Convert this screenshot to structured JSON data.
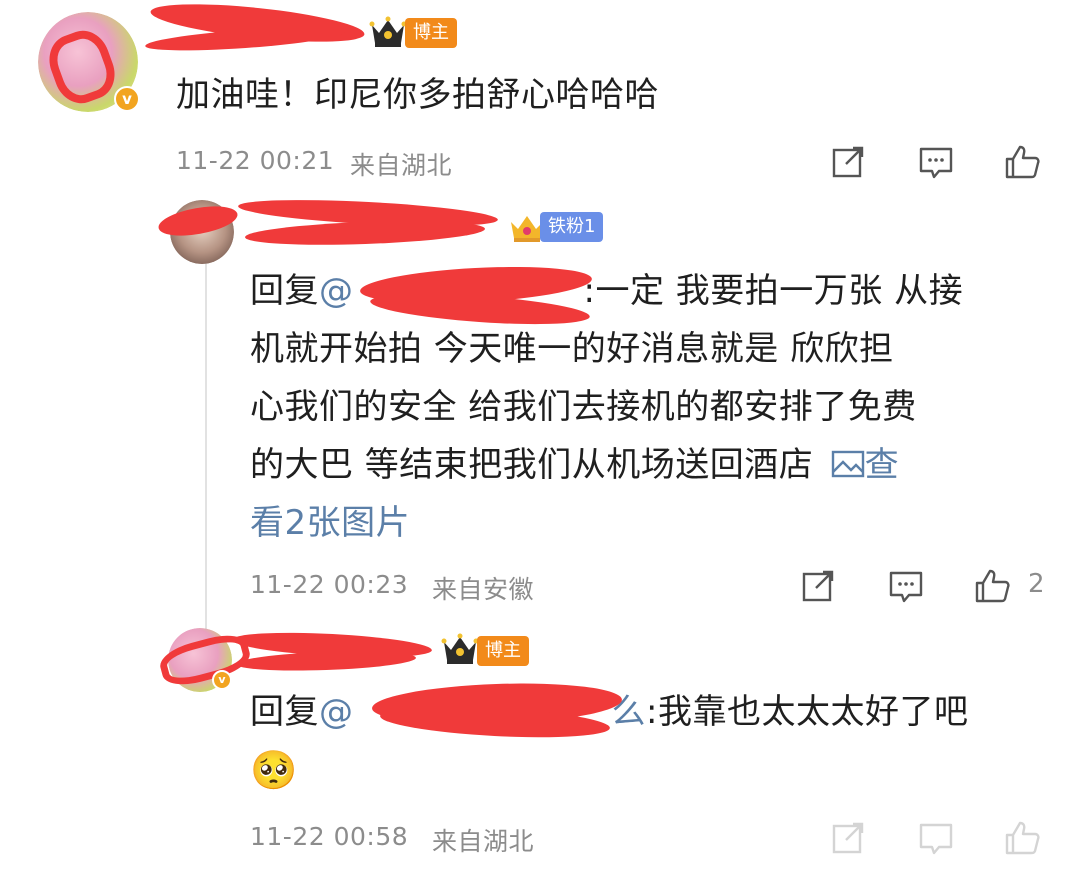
{
  "comments": [
    {
      "badge": "博主",
      "text": "加油哇！印尼你多拍舒心哈哈哈",
      "time": "11-22 00:21",
      "location": "来自湖北"
    },
    {
      "badge": "铁粉1",
      "reply_prefix": "回复",
      "mention_at": "@",
      "text": ":一定 我要拍一万张 从接机就开始拍 今天唯一的好消息就是 欣欣担心我们的安全 给我们去接机的都安排了免费的大巴 等结束把我们从机场送回酒店",
      "line1": ":一定 我要拍一万张 从接",
      "line2": "机就开始拍 今天唯一的好消息就是 欣欣担",
      "line3": "心我们的安全 给我们去接机的都安排了免费",
      "line4": "的大巴 等结束把我们从机场送回酒店",
      "image_link_a": "查",
      "image_link_b": "看2张图片",
      "time": "11-22 00:23",
      "location": "来自安徽",
      "likes": "2"
    },
    {
      "badge": "博主",
      "reply_prefix": "回复",
      "mention_at": "@",
      "mention_tail": "么",
      "text": ":我靠也太太太好了吧",
      "emoji": "🥺",
      "time": "11-22 00:58",
      "location": "来自湖北"
    }
  ],
  "icons": {
    "share": "share-icon",
    "comment": "comment-icon",
    "like": "like-icon",
    "image": "image-icon"
  },
  "colors": {
    "badge_orange": "#f28a1a",
    "badge_blue": "#6a8fe8",
    "link": "#5b7fa8",
    "meta": "#8c8c8c",
    "redaction": "#f03a3a"
  }
}
